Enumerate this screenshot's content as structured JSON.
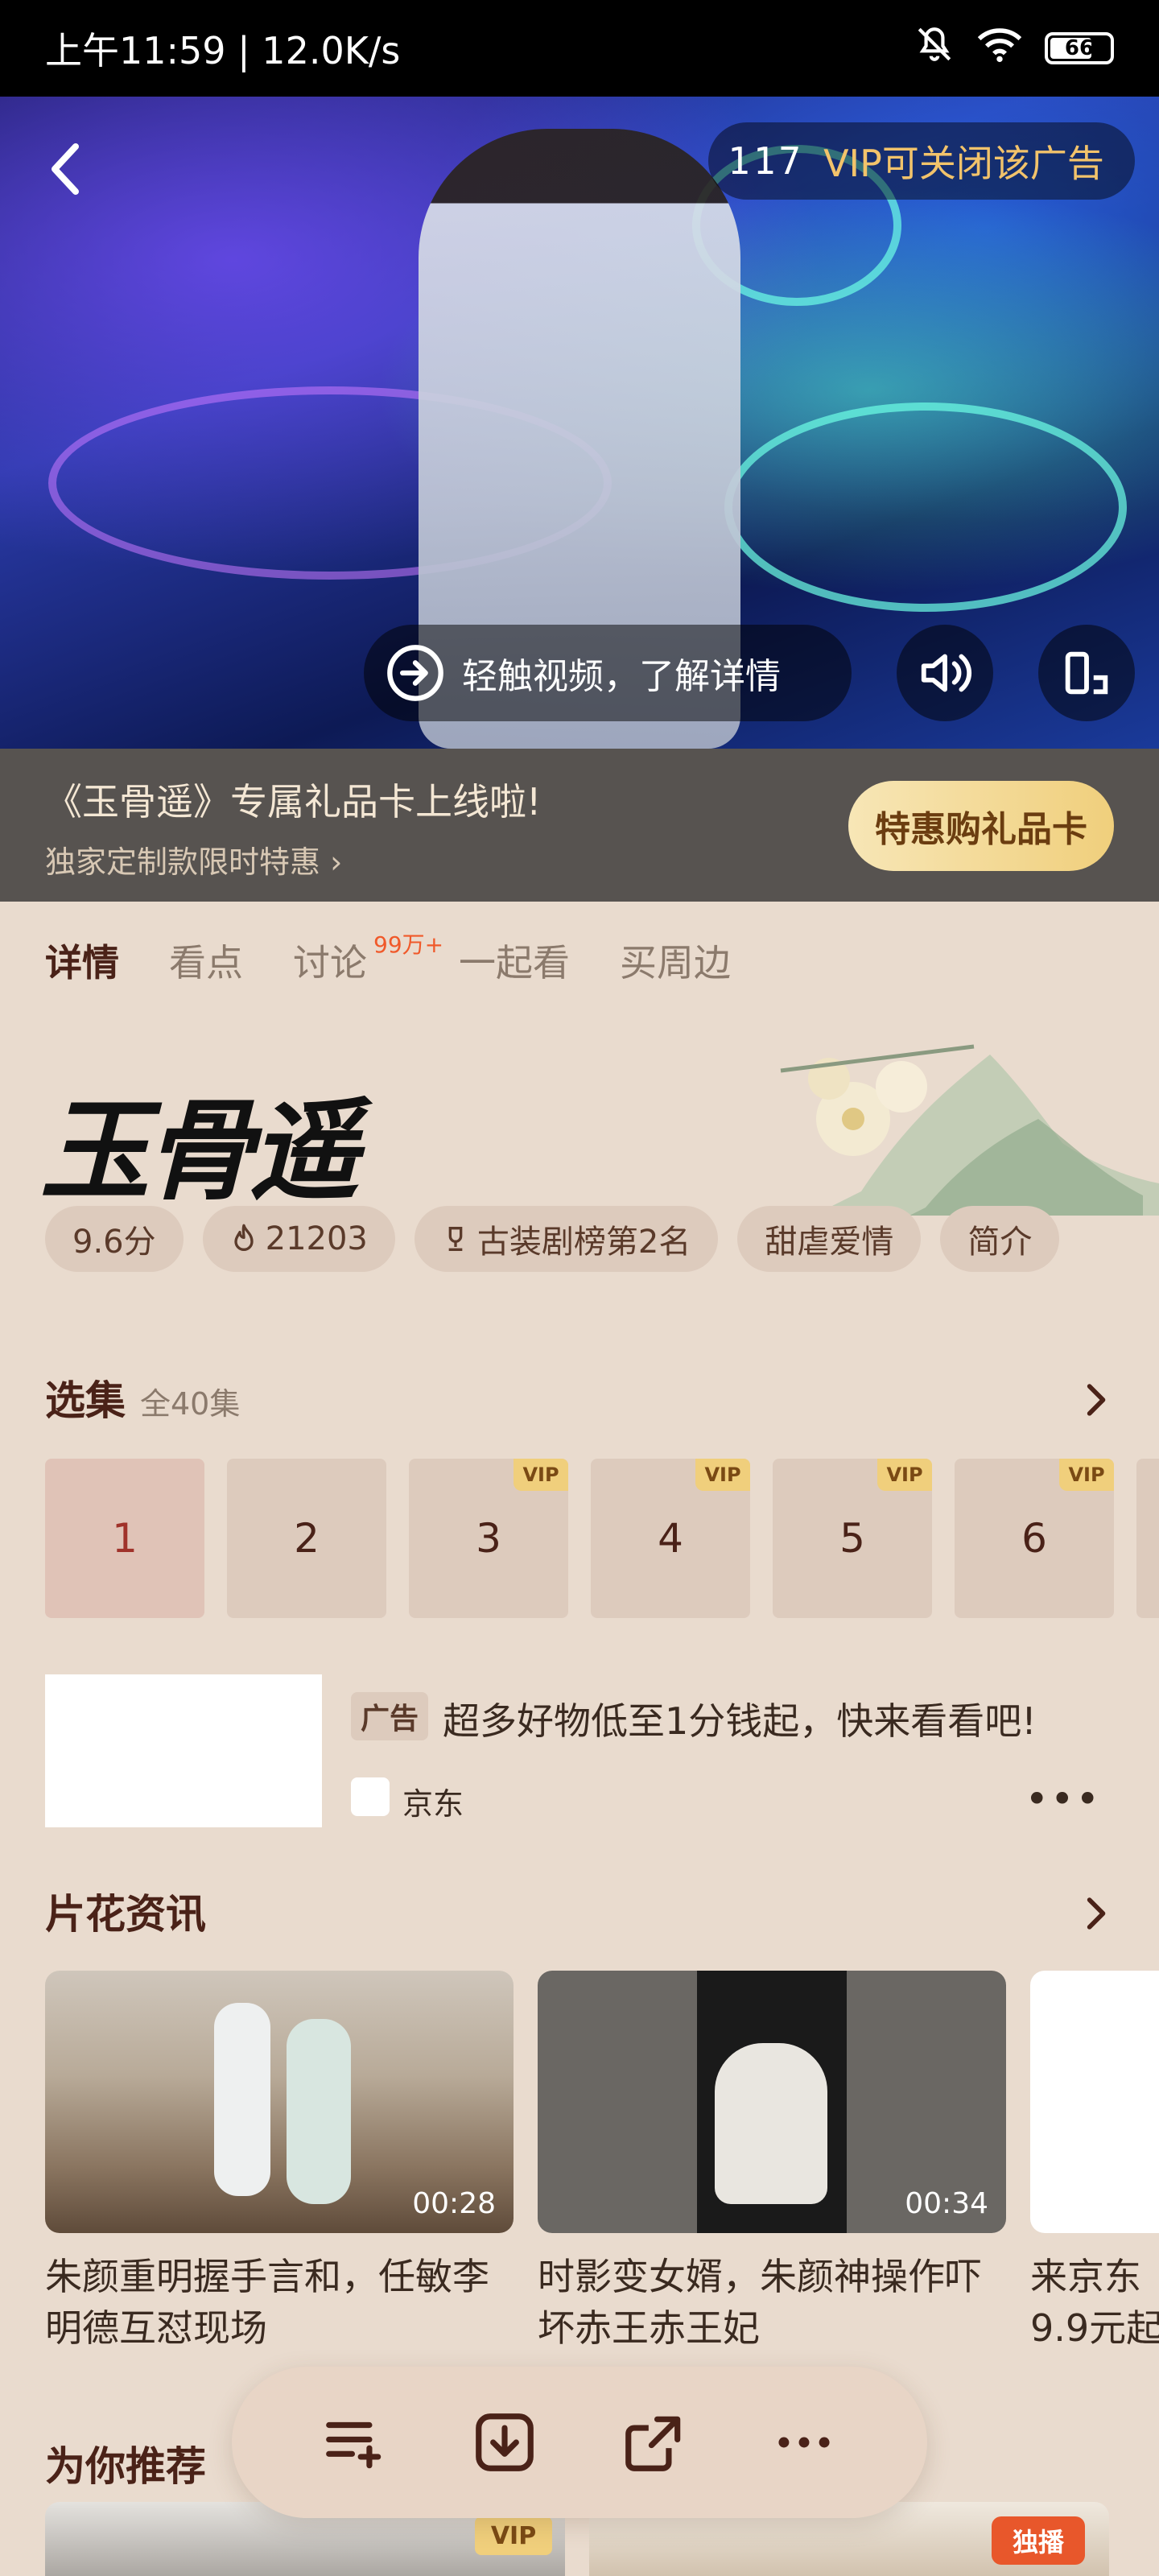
{
  "status_bar": {
    "time": "上午11:59 | 12.0K/s",
    "battery": "66",
    "icons": [
      "mute-icon",
      "wifi-icon",
      "battery-icon"
    ]
  },
  "video": {
    "ad_countdown": "117",
    "ad_vip_text": "VIP可关闭该广告",
    "touch_text": "轻触视频，了解详情"
  },
  "promo": {
    "title": "《玉骨遥》专属礼品卡上线啦!",
    "subtitle": "独家定制款限时特惠 ›",
    "button": "特惠购礼品卡"
  },
  "tabs": [
    {
      "label": "详情",
      "active": true
    },
    {
      "label": "看点"
    },
    {
      "label": "讨论",
      "badge": "99万+"
    },
    {
      "label": "一起看"
    },
    {
      "label": "买周边"
    }
  ],
  "show": {
    "title": "玉骨遥",
    "tags": [
      "9.6分",
      "21203",
      "古装剧榜第2名",
      "甜虐爱情",
      "简介"
    ]
  },
  "episodes": {
    "title": "选集",
    "total": "全40集",
    "items": [
      {
        "num": "1",
        "vip": ""
      },
      {
        "num": "2",
        "vip": ""
      },
      {
        "num": "3",
        "vip": "VIP"
      },
      {
        "num": "4",
        "vip": "VIP"
      },
      {
        "num": "5",
        "vip": "VIP"
      },
      {
        "num": "6",
        "vip": "VIP"
      }
    ]
  },
  "ad_card": {
    "label": "广告",
    "text": "超多好物低至1分钱起，快来看看吧!",
    "brand": "京东"
  },
  "clips": {
    "title": "片花资讯",
    "items": [
      {
        "duration": "00:28",
        "title": "朱颜重明握手言和，任敏李明德互怼现场"
      },
      {
        "duration": "00:34",
        "title": "时影变女婿，朱颜神操作吓坏赤王赤王妃"
      },
      {
        "duration": "",
        "title": "来京东9.9元起"
      }
    ]
  },
  "recommend": {
    "title": "为你推荐",
    "cards": [
      {
        "badge": "VIP"
      },
      {
        "badge": "独播"
      }
    ]
  },
  "colors": {
    "background": "#e9dbce",
    "accent": "#f0cf7c",
    "title_dark": "#4a2218"
  }
}
